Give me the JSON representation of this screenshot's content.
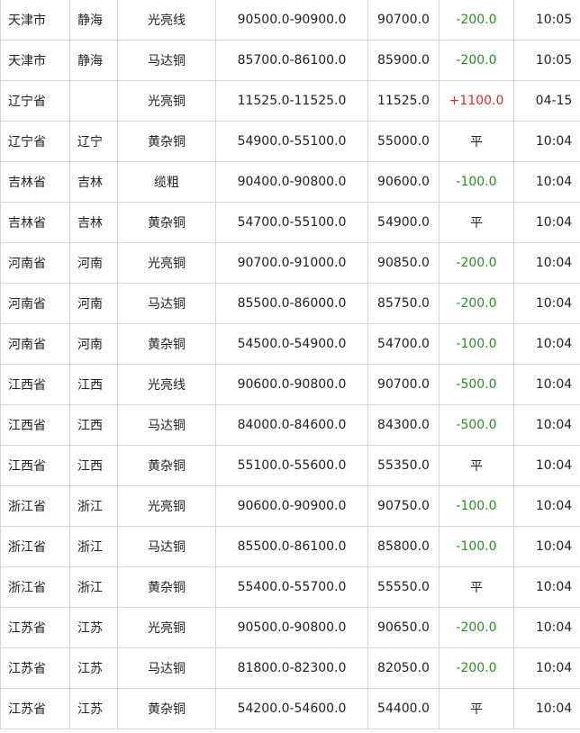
{
  "colors": {
    "down": "#2e8b2e",
    "up": "#d42b2b",
    "flat": "#222222",
    "border": "#d6d6d6"
  },
  "rows": [
    {
      "province": "天津市",
      "city": "静海",
      "product": "光亮线",
      "range": "90500.0-90900.0",
      "avg": "90700.0",
      "change": "-200.0",
      "trend": "down",
      "time": "10:05"
    },
    {
      "province": "天津市",
      "city": "静海",
      "product": "马达铜",
      "range": "85700.0-86100.0",
      "avg": "85900.0",
      "change": "-200.0",
      "trend": "down",
      "time": "10:05"
    },
    {
      "province": "辽宁省",
      "city": "",
      "product": "光亮铜",
      "range": "11525.0-11525.0",
      "avg": "11525.0",
      "change": "+1100.0",
      "trend": "up",
      "time": "04-15"
    },
    {
      "province": "辽宁省",
      "city": "辽宁",
      "product": "黄杂铜",
      "range": "54900.0-55100.0",
      "avg": "55000.0",
      "change": "平",
      "trend": "flat",
      "time": "10:04"
    },
    {
      "province": "吉林省",
      "city": "吉林",
      "product": "缆粗",
      "range": "90400.0-90800.0",
      "avg": "90600.0",
      "change": "-100.0",
      "trend": "down",
      "time": "10:04"
    },
    {
      "province": "吉林省",
      "city": "吉林",
      "product": "黄杂铜",
      "range": "54700.0-55100.0",
      "avg": "54900.0",
      "change": "平",
      "trend": "flat",
      "time": "10:04"
    },
    {
      "province": "河南省",
      "city": "河南",
      "product": "光亮铜",
      "range": "90700.0-91000.0",
      "avg": "90850.0",
      "change": "-200.0",
      "trend": "down",
      "time": "10:04"
    },
    {
      "province": "河南省",
      "city": "河南",
      "product": "马达铜",
      "range": "85500.0-86000.0",
      "avg": "85750.0",
      "change": "-200.0",
      "trend": "down",
      "time": "10:04"
    },
    {
      "province": "河南省",
      "city": "河南",
      "product": "黄杂铜",
      "range": "54500.0-54900.0",
      "avg": "54700.0",
      "change": "-100.0",
      "trend": "down",
      "time": "10:04"
    },
    {
      "province": "江西省",
      "city": "江西",
      "product": "光亮线",
      "range": "90600.0-90800.0",
      "avg": "90700.0",
      "change": "-500.0",
      "trend": "down",
      "time": "10:04"
    },
    {
      "province": "江西省",
      "city": "江西",
      "product": "马达铜",
      "range": "84000.0-84600.0",
      "avg": "84300.0",
      "change": "-500.0",
      "trend": "down",
      "time": "10:04"
    },
    {
      "province": "江西省",
      "city": "江西",
      "product": "黄杂铜",
      "range": "55100.0-55600.0",
      "avg": "55350.0",
      "change": "平",
      "trend": "flat",
      "time": "10:04"
    },
    {
      "province": "浙江省",
      "city": "浙江",
      "product": "光亮铜",
      "range": "90600.0-90900.0",
      "avg": "90750.0",
      "change": "-100.0",
      "trend": "down",
      "time": "10:04"
    },
    {
      "province": "浙江省",
      "city": "浙江",
      "product": "马达铜",
      "range": "85500.0-86100.0",
      "avg": "85800.0",
      "change": "-100.0",
      "trend": "down",
      "time": "10:04"
    },
    {
      "province": "浙江省",
      "city": "浙江",
      "product": "黄杂铜",
      "range": "55400.0-55700.0",
      "avg": "55550.0",
      "change": "平",
      "trend": "flat",
      "time": "10:04"
    },
    {
      "province": "江苏省",
      "city": "江苏",
      "product": "光亮铜",
      "range": "90500.0-90800.0",
      "avg": "90650.0",
      "change": "-200.0",
      "trend": "down",
      "time": "10:04"
    },
    {
      "province": "江苏省",
      "city": "江苏",
      "product": "马达铜",
      "range": "81800.0-82300.0",
      "avg": "82050.0",
      "change": "-200.0",
      "trend": "down",
      "time": "10:04"
    },
    {
      "province": "江苏省",
      "city": "江苏",
      "product": "黄杂铜",
      "range": "54200.0-54600.0",
      "avg": "54400.0",
      "change": "平",
      "trend": "flat",
      "time": "10:04"
    }
  ]
}
